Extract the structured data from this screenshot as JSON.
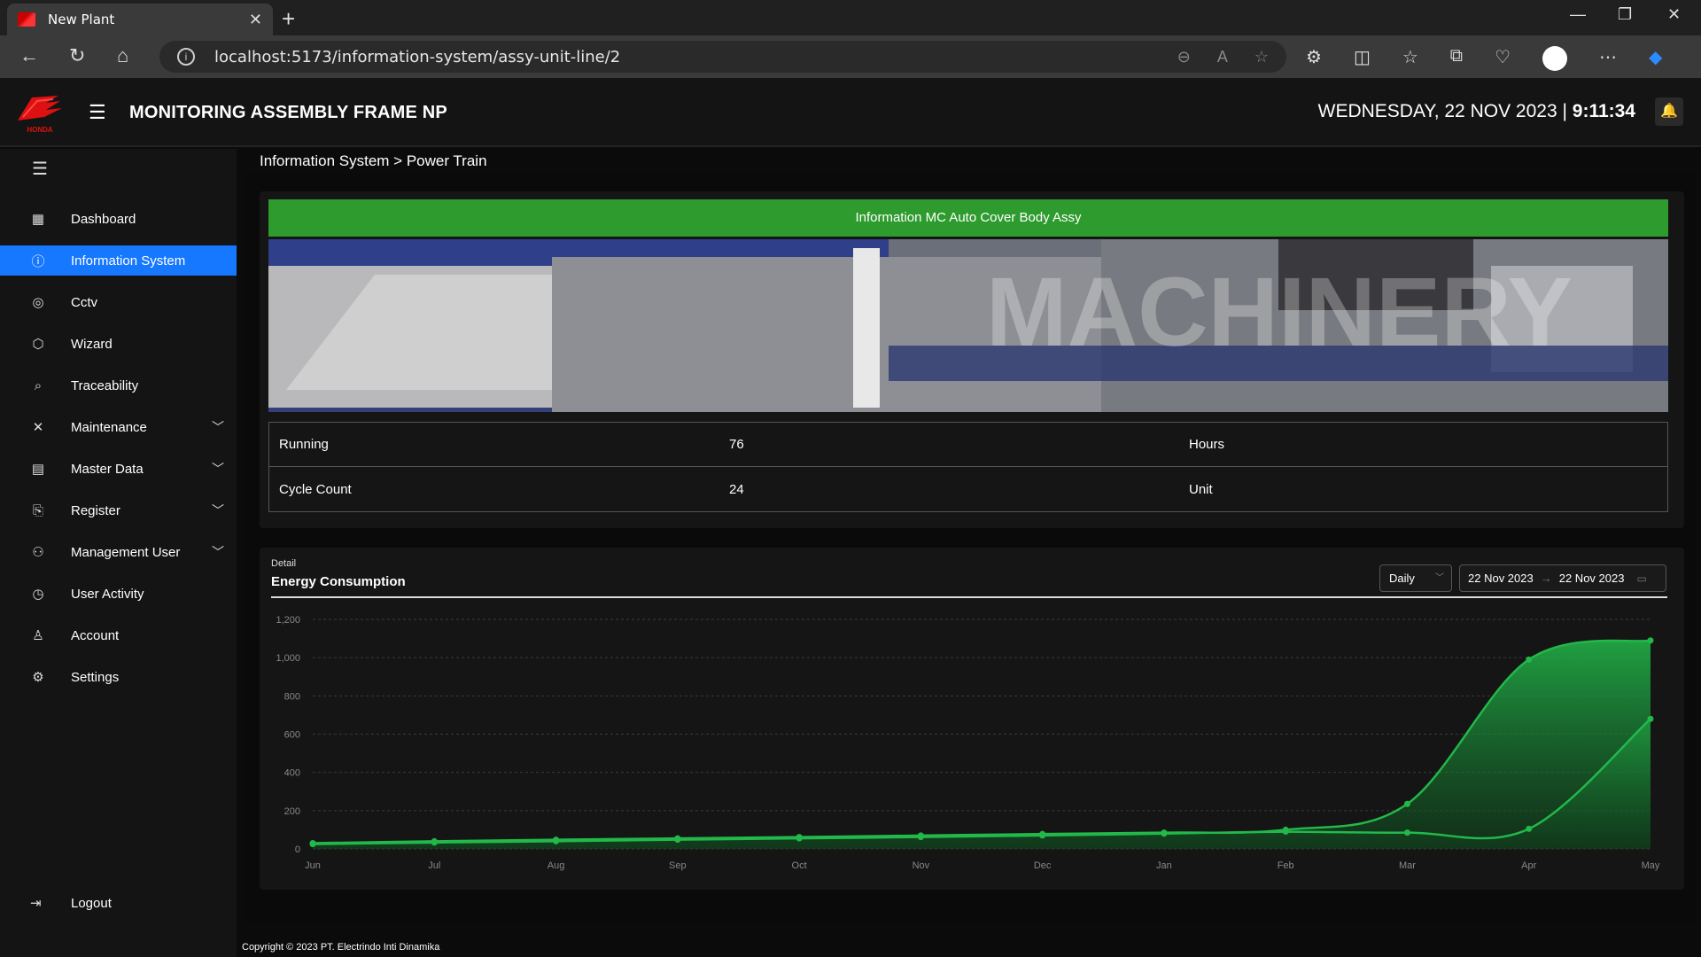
{
  "browser": {
    "tab_title": "New Plant",
    "url": "localhost:5173/information-system/assy-unit-line/2"
  },
  "header": {
    "app_title": "MONITORING ASSEMBLY FRAME NP",
    "date": "WEDNESDAY, 22 NOV 2023",
    "time": "9:11:34"
  },
  "sidebar": {
    "items": [
      {
        "label": "Dashboard",
        "icon": "dashboard-icon"
      },
      {
        "label": "Information System",
        "icon": "info-icon"
      },
      {
        "label": "Cctv",
        "icon": "cctv-icon"
      },
      {
        "label": "Wizard",
        "icon": "cube-icon"
      },
      {
        "label": "Traceability",
        "icon": "traceability-icon"
      },
      {
        "label": "Maintenance",
        "icon": "tools-icon"
      },
      {
        "label": "Master Data",
        "icon": "file-icon"
      },
      {
        "label": "Register",
        "icon": "register-icon"
      },
      {
        "label": "Management User",
        "icon": "user-manage-icon"
      },
      {
        "label": "User Activity",
        "icon": "history-icon"
      },
      {
        "label": "Account",
        "icon": "user-icon"
      },
      {
        "label": "Settings",
        "icon": "gear-icon"
      }
    ],
    "logout": "Logout"
  },
  "breadcrumb": "Information System > Power Train",
  "machine": {
    "header": "Information MC Auto Cover Body Assy",
    "image_text": "MACHINERY",
    "stats": [
      {
        "label": "Running",
        "value": "76",
        "unit": "Hours"
      },
      {
        "label": "Cycle Count",
        "value": "24",
        "unit": "Unit"
      }
    ]
  },
  "energy": {
    "subtitle": "Detail",
    "title": "Energy Consumption",
    "period": "Daily",
    "date_from": "22 Nov 2023",
    "date_to": "22 Nov 2023"
  },
  "footer": "Copyright © 2023 PT. Electrindo Inti Dinamika",
  "colors": {
    "accent": "#1677ff",
    "green": "#2e9b2e",
    "series": "#22b84a"
  },
  "chart_data": {
    "type": "area",
    "categories": [
      "Jun",
      "Jul",
      "Aug",
      "Sep",
      "Oct",
      "Nov",
      "Dec",
      "Jan",
      "Feb",
      "Mar",
      "Apr",
      "May"
    ],
    "ylim": [
      0,
      1200
    ],
    "yticks": [
      "0",
      "200",
      "400",
      "600",
      "800",
      "1,000",
      "1,200"
    ],
    "grid": true,
    "series": [
      {
        "values": [
          30,
          40,
          48,
          55,
          62,
          70,
          78,
          85,
          100,
          235,
          990,
          1090
        ]
      },
      {
        "values": [
          25,
          33,
          40,
          48,
          55,
          62,
          70,
          80,
          90,
          85,
          105,
          680
        ]
      }
    ]
  }
}
